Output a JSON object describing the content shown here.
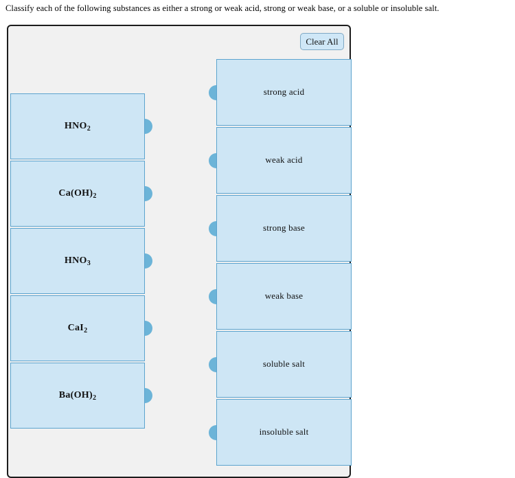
{
  "prompt": "Classify each of the following substances as either a strong or weak acid, strong or weak base, or a soluble or insoluble salt.",
  "toolbar": {
    "clear_all_label": "Clear All"
  },
  "colors": {
    "tile_fill": "#cee6f5",
    "tile_border": "#5ba3ce",
    "knob": "#6cb4d8",
    "panel_bg": "#f1f1f1",
    "panel_border": "#1c1c1c",
    "button_fill": "#cfe7f7",
    "button_border": "#7fa8c4"
  },
  "substances": [
    {
      "formula_html": "HNO<sub>2</sub>",
      "plain": "HNO2"
    },
    {
      "formula_html": "Ca(OH)<sub>2</sub>",
      "plain": "Ca(OH)2"
    },
    {
      "formula_html": "HNO<sub>3</sub>",
      "plain": "HNO3"
    },
    {
      "formula_html": "CaI<sub>2</sub>",
      "plain": "CaI2"
    },
    {
      "formula_html": "Ba(OH)<sub>2</sub>",
      "plain": "Ba(OH)2"
    }
  ],
  "categories": [
    {
      "label": "strong acid"
    },
    {
      "label": "weak acid"
    },
    {
      "label": "strong base"
    },
    {
      "label": "weak base"
    },
    {
      "label": "soluble salt"
    },
    {
      "label": "insoluble salt"
    }
  ]
}
